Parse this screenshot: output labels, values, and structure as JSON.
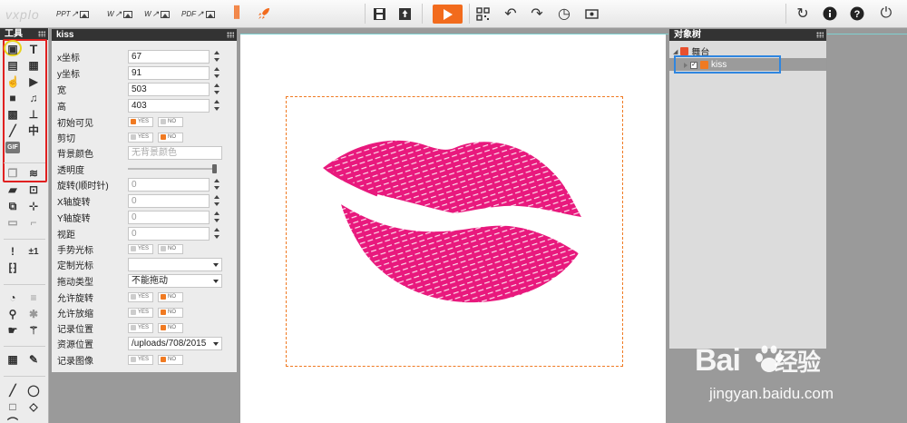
{
  "toolbar": {
    "logo": "vxplo",
    "exports": [
      {
        "label": "PPT",
        "icon": "ppt-export-icon"
      },
      {
        "label": "W",
        "icon": "word-export-icon"
      },
      {
        "label": "W",
        "icon": "web-export-icon"
      },
      {
        "label": "PDF",
        "icon": "pdf-export-icon"
      }
    ],
    "accent_color": "#f26b1d"
  },
  "tools_panel": {
    "title": "工具",
    "text_tool": "T",
    "text_tool2": "中",
    "gif_tool": "GIF",
    "counter_tool": "±1"
  },
  "props_panel": {
    "title": "kiss",
    "x_label": "x坐标",
    "x_value": "67",
    "y_label": "y坐标",
    "y_value": "91",
    "w_label": "宽",
    "w_value": "503",
    "h_label": "高",
    "h_value": "403",
    "visible_label": "初始可见",
    "clip_label": "剪切",
    "bg_label": "背景颜色",
    "bg_placeholder": "无背景颜色",
    "opacity_label": "透明度",
    "opacity_value": 1.0,
    "rot_label": "旋转(顺时针)",
    "rot_value": "0",
    "xrot_label": "X轴旋转",
    "xrot_value": "0",
    "yrot_label": "Y轴旋转",
    "yrot_value": "0",
    "dist_label": "视距",
    "dist_value": "0",
    "hand_label": "手势光标",
    "cursor_label": "定制光标",
    "cursor_value": "",
    "drag_label": "拖动类型",
    "drag_value": "不能拖动",
    "allow_rot_label": "允许旋转",
    "allow_scale_label": "允许放缩",
    "record_pos_label": "记录位置",
    "src_label": "资源位置",
    "src_value": "/uploads/708/2015",
    "record_img_label": "记录图像",
    "yes": "YES",
    "no": "NO"
  },
  "tree_panel": {
    "title": "对象树",
    "stage_label": "舞台",
    "item_label": "kiss",
    "item_check": "✓"
  },
  "watermark": {
    "brand1": "Bai",
    "brand2": "经验",
    "url": "jingyan.baidu.com"
  }
}
